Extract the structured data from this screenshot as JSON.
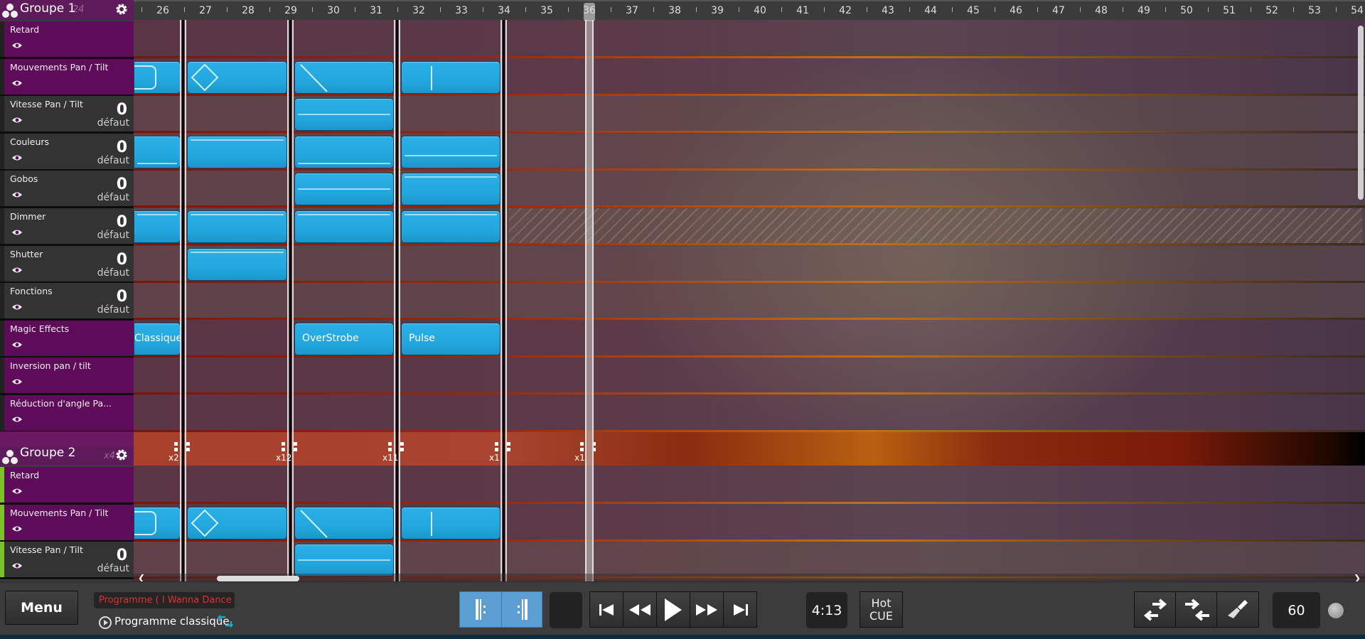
{
  "ruler": {
    "bars": [
      "26",
      "27",
      "28",
      "29",
      "30",
      "31",
      "32",
      "33",
      "34",
      "35",
      "36",
      "37",
      "38",
      "39",
      "40",
      "41",
      "42",
      "43",
      "44",
      "45",
      "46",
      "47",
      "48",
      "49",
      "50",
      "51",
      "52",
      "53",
      "54"
    ],
    "playhead_bar": "36"
  },
  "groups": [
    {
      "title": "Groupe 1",
      "count": "24",
      "tracks": [
        {
          "name": "Retard",
          "type": "effect"
        },
        {
          "name": "Mouvements Pan / Tilt",
          "type": "effect"
        },
        {
          "name": "Vitesse Pan / Tilt",
          "type": "param",
          "value": "0",
          "value_label": "défaut"
        },
        {
          "name": "Couleurs",
          "type": "param",
          "value": "0",
          "value_label": "défaut"
        },
        {
          "name": "Gobos",
          "type": "param",
          "value": "0",
          "value_label": "défaut"
        },
        {
          "name": "Dimmer",
          "type": "param",
          "value": "0",
          "value_label": "défaut"
        },
        {
          "name": "Shutter",
          "type": "param",
          "value": "0",
          "value_label": "défaut"
        },
        {
          "name": "Fonctions",
          "type": "param",
          "value": "0",
          "value_label": "défaut"
        },
        {
          "name": "Magic Effects",
          "type": "effect"
        },
        {
          "name": "Inversion pan / tilt",
          "type": "effect"
        },
        {
          "name": "Réduction d'angle Pa...",
          "type": "effect"
        }
      ]
    },
    {
      "title": "Groupe 2",
      "count": "x4",
      "tracks": [
        {
          "name": "Retard",
          "type": "effect"
        },
        {
          "name": "Mouvements Pan / Tilt",
          "type": "effect"
        },
        {
          "name": "Vitesse Pan / Tilt",
          "type": "param",
          "value": "0",
          "value_label": "défaut"
        }
      ]
    }
  ],
  "blocks": {
    "magic_effects": [
      "Classique",
      "OverStrobe",
      "Pulse"
    ],
    "pan_tilt_shapes": [
      "rounded-rect",
      "diamond",
      "diagonal-line",
      "vertical-line"
    ]
  },
  "loop_sections": [
    "x2",
    "x12",
    "x11",
    "x1",
    "x1"
  ],
  "toolbar": {
    "menu_label": "Menu",
    "program_title": "Programme ( I Wanna Dance Latin",
    "program_name": "Programme classique",
    "time": "4:13",
    "hotcue_line1": "Hot",
    "hotcue_line2": "CUE",
    "bpm": "60"
  },
  "colors": {
    "block": "#22a8de",
    "effect_track": "#5e0c5a",
    "param_track": "#333333",
    "group2_accent": "#7cc12b",
    "program_title_text": "#e03030",
    "loop_active": "#5a9ed2"
  }
}
